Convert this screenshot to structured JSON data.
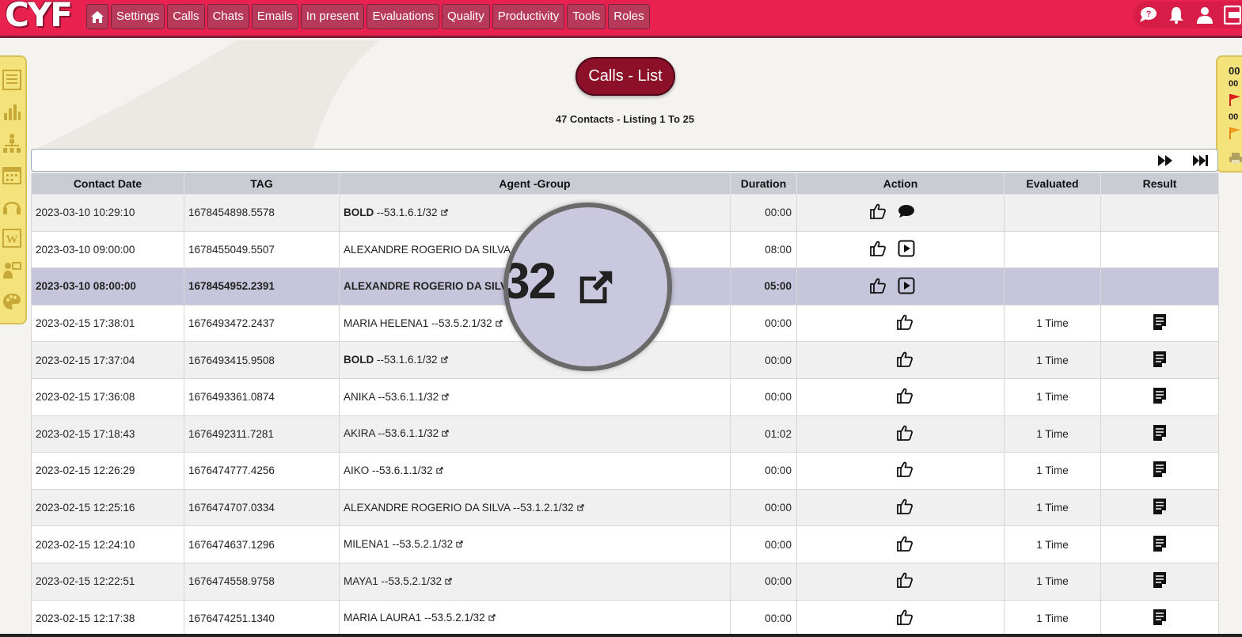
{
  "app": {
    "logo": "CYF"
  },
  "nav": [
    "Settings",
    "Calls",
    "Chats",
    "Emails",
    "In present",
    "Evaluations",
    "Quality",
    "Productivity",
    "Tools",
    "Roles"
  ],
  "page": {
    "title": "Calls - List",
    "listing": "47 Contacts - Listing 1 To 25"
  },
  "right_sidebar": {
    "counter1": "00",
    "counter2": "00",
    "counter3": "00"
  },
  "table": {
    "headers": {
      "date": "Contact Date",
      "tag": "TAG",
      "agent": "Agent -Group",
      "duration": "Duration",
      "action": "Action",
      "evaluated": "Evaluated",
      "result": "Result"
    },
    "rows": [
      {
        "date": "2023-03-10 10:29:10",
        "tag": "1678454898.5578",
        "agent_name": "BOLD",
        "agent_group": " --53.1.6.1/32",
        "duration": "00:00",
        "evaluated": "",
        "actions": "like-chat",
        "has_result": false
      },
      {
        "date": "2023-03-10 09:00:00",
        "tag": "1678455049.5507",
        "agent_name": "ALEXANDRE ROGERIO DA SILVA --",
        "agent_group": "",
        "duration": "08:00",
        "evaluated": "",
        "actions": "like-play",
        "has_result": false
      },
      {
        "date": "2023-03-10 08:00:00",
        "tag": "1678454952.2391",
        "agent_name": "ALEXANDRE ROGERIO DA SILVA",
        "agent_group": "",
        "duration": "05:00",
        "evaluated": "",
        "actions": "like-play",
        "has_result": false
      },
      {
        "date": "2023-02-15 17:38:01",
        "tag": "1676493472.2437",
        "agent_name": "MARIA HELENA1",
        "agent_group": " --53.5.2.1/32",
        "duration": "00:00",
        "evaluated": "1 Time",
        "actions": "like",
        "has_result": true
      },
      {
        "date": "2023-02-15 17:37:04",
        "tag": "1676493415.9508",
        "agent_name": "BOLD",
        "agent_group": " --53.1.6.1/32",
        "duration": "00:00",
        "evaluated": "1 Time",
        "actions": "like",
        "has_result": true
      },
      {
        "date": "2023-02-15 17:36:08",
        "tag": "1676493361.0874",
        "agent_name": "ANIKA",
        "agent_group": " --53.6.1.1/32",
        "duration": "00:00",
        "evaluated": "1 Time",
        "actions": "like",
        "has_result": true
      },
      {
        "date": "2023-02-15 17:18:43",
        "tag": "1676492311.7281",
        "agent_name": "AKIRA",
        "agent_group": " --53.6.1.1/32",
        "duration": "01:02",
        "evaluated": "1 Time",
        "actions": "like",
        "has_result": true
      },
      {
        "date": "2023-02-15 12:26:29",
        "tag": "1676474777.4256",
        "agent_name": "AIKO",
        "agent_group": " --53.6.1.1/32",
        "duration": "00:00",
        "evaluated": "1 Time",
        "actions": "like",
        "has_result": true
      },
      {
        "date": "2023-02-15 12:25:16",
        "tag": "1676474707.0334",
        "agent_name": "ALEXANDRE ROGERIO DA SILVA",
        "agent_group": " --53.1.2.1/32",
        "duration": "00:00",
        "evaluated": "1 Time",
        "actions": "like",
        "has_result": true
      },
      {
        "date": "2023-02-15 12:24:10",
        "tag": "1676474637.1296",
        "agent_name": "MILENA1",
        "agent_group": " --53.5.2.1/32",
        "duration": "00:00",
        "evaluated": "1 Time",
        "actions": "like",
        "has_result": true
      },
      {
        "date": "2023-02-15 12:22:51",
        "tag": "1676474558.9758",
        "agent_name": "MAYA1",
        "agent_group": " --53.5.2.1/32",
        "duration": "00:00",
        "evaluated": "1 Time",
        "actions": "like",
        "has_result": true
      },
      {
        "date": "2023-02-15 12:17:38",
        "tag": "1676474251.1340",
        "agent_name": "MARIA LAURA1",
        "agent_group": " --53.5.2.1/32",
        "duration": "00:00",
        "evaluated": "1 Time",
        "actions": "like",
        "has_result": true
      }
    ]
  },
  "magnifier": {
    "text": "32"
  },
  "colors": {
    "topbar": "#e8214f",
    "nav_button": "#b83a5a",
    "title_pill": "#8b1028",
    "sidebar": "#f4e27a",
    "selected_row": "#c6c5db"
  },
  "icons": {
    "home": "home-icon",
    "help": "help-chat-icon",
    "bell": "bell-icon",
    "user": "user-icon",
    "logout": "logout-icon",
    "like": "thumbs-up-icon",
    "chat": "chat-bubble-icon",
    "play": "play-icon",
    "result": "document-icon",
    "external": "external-link-icon",
    "next": "fast-forward-icon",
    "last": "skip-to-end-icon"
  }
}
